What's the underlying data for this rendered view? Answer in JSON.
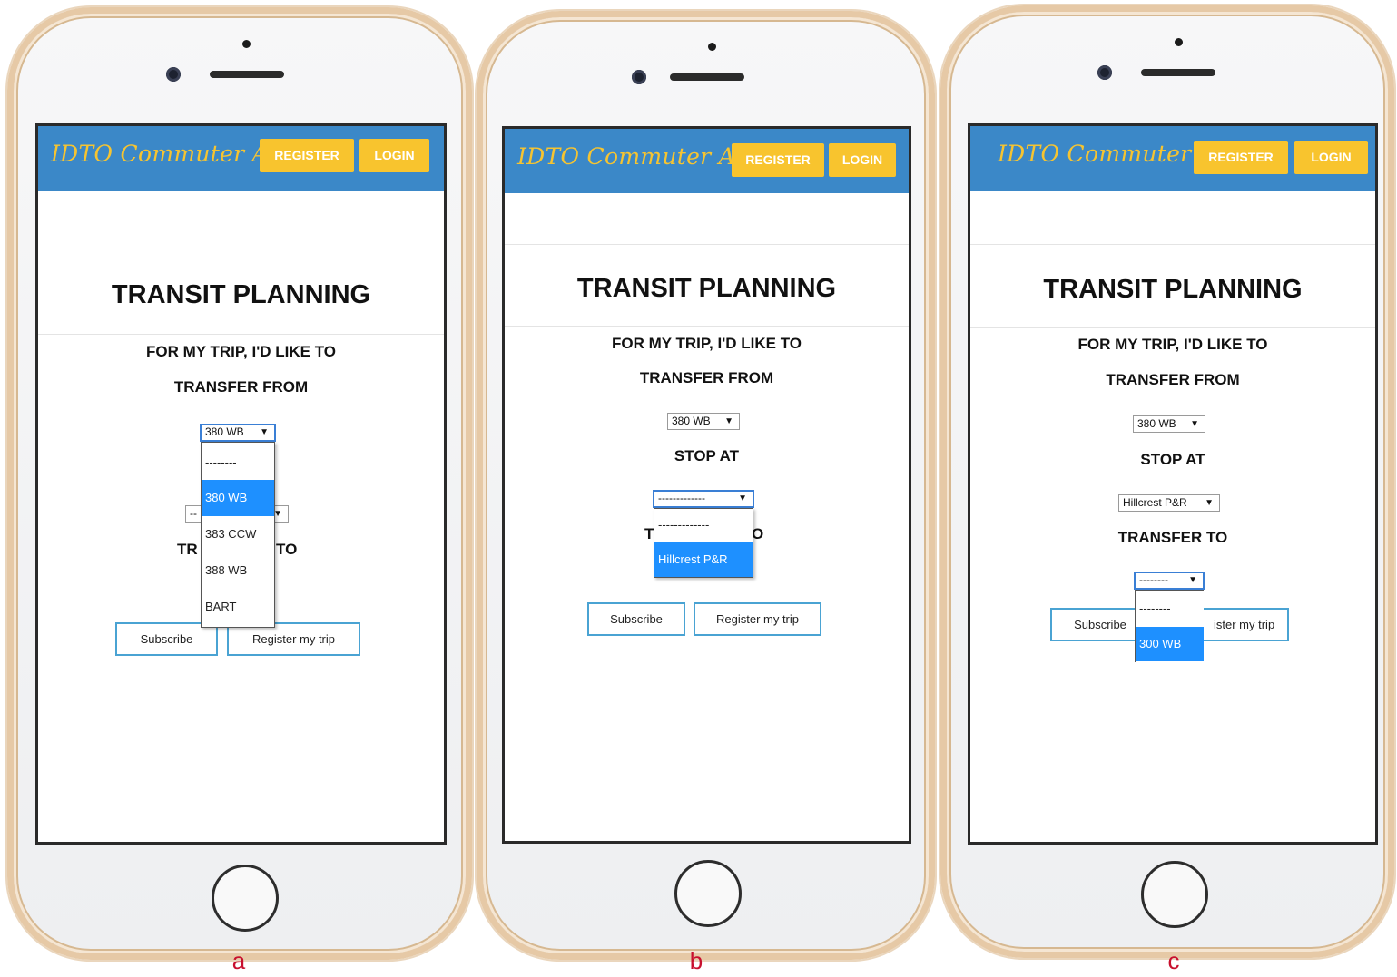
{
  "header": {
    "brand": "IDTO Commuter App",
    "register": "REGISTER",
    "login": "LOGIN"
  },
  "page": {
    "title": "TRANSIT PLANNING",
    "subtitle": "FOR MY TRIP, I'D LIKE TO",
    "transfer_from": "TRANSFER FROM",
    "stop_at": "STOP AT",
    "transfer_to": "TRANSFER TO"
  },
  "buttons": {
    "subscribe": "Subscribe",
    "register_trip": "Register my trip"
  },
  "panels": {
    "a": {
      "caption": "a",
      "transfer_from_value": "380 WB",
      "partial_heading_left": "TR",
      "partial_heading_right": "TO",
      "dropdown": [
        "--------",
        "380 WB",
        "383 CCW",
        "388 WB",
        "BART"
      ],
      "dropdown_selected": "380 WB"
    },
    "b": {
      "caption": "b",
      "transfer_from_value": "380 WB",
      "stop_at_value": "-------------",
      "partial_heading_left": "T",
      "partial_heading_right": "O",
      "dropdown": [
        "-------------",
        "Hillcrest P&R"
      ],
      "dropdown_selected": "Hillcrest P&R"
    },
    "c": {
      "caption": "c",
      "transfer_from_value": "380 WB",
      "stop_at_value": "Hillcrest P&R",
      "transfer_to_value": "--------",
      "partial_button_text": "ister my trip",
      "dropdown": [
        "--------",
        "300 WB"
      ],
      "dropdown_selected": "300 WB"
    }
  },
  "arrow_glyph": "▼"
}
